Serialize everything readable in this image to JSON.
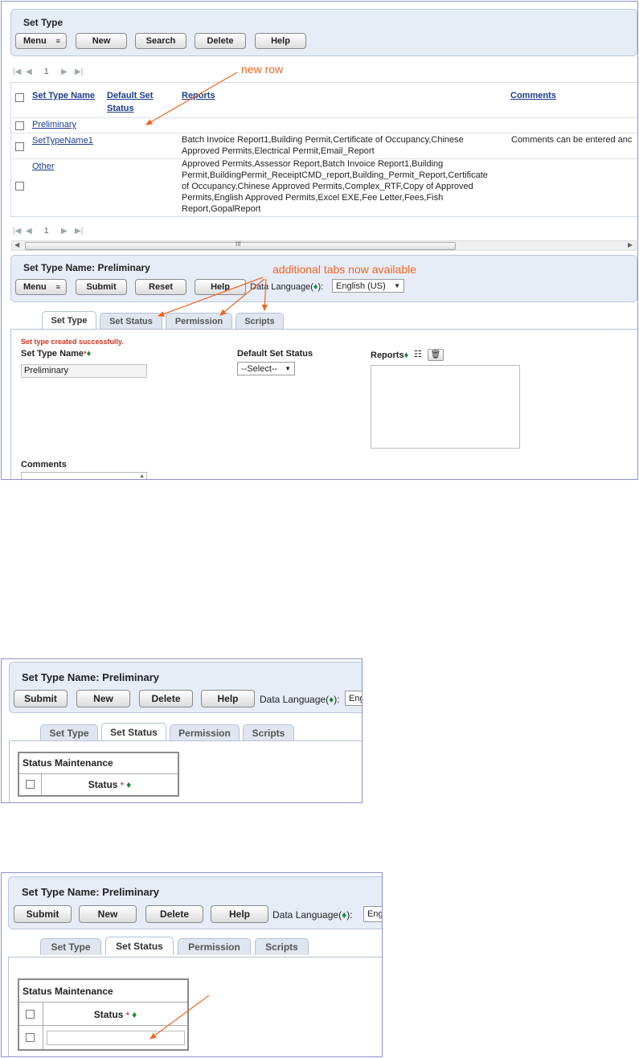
{
  "set_type_panel": {
    "title": "Set Type",
    "menu_label": "Menu",
    "buttons": {
      "new": "New",
      "search": "Search",
      "delete": "Delete",
      "help": "Help"
    }
  },
  "pager": {
    "page": "1"
  },
  "table": {
    "headers": {
      "name": "Set Type Name",
      "status_line1": "Default Set",
      "status_line2": "Status",
      "reports": "Reports",
      "comments": "Comments"
    },
    "rows": [
      {
        "name": "Preliminary",
        "reports": [],
        "comments": ""
      },
      {
        "name": "SetTypeName1",
        "reports": [
          "Batch Invoice Report1,Building Permit,Certificate of Occupancy,Chinese",
          "Approved Permits,Electrical Permit,Email_Report"
        ],
        "comments": "Comments can be entered anc"
      },
      {
        "name": "Other",
        "reports": [
          "Approved Permits,Assessor Report,Batch Invoice Report1,Building",
          "Permit,BuildingPermit_ReceiptCMD_report,Building_Permit_Report,Certificate",
          "of Occupancy,Chinese Approved Permits,Complex_RTF,Copy of Approved",
          "Permits,English Approved Permits,Excel EXE,Fee Letter,Fees,Fish",
          "Report,GopalReport"
        ],
        "comments": ""
      }
    ]
  },
  "annotations": {
    "new_row": "new row",
    "tabs_available": "additional tabs now available"
  },
  "detail_panel": {
    "title": "Set Type Name: Preliminary",
    "menu_label": "Menu",
    "buttons": {
      "submit": "Submit",
      "reset": "Reset",
      "help": "Help"
    },
    "data_language_prefix": "Data Language(",
    "data_language_suffix": "):",
    "language_value": "English (US)"
  },
  "tabs": {
    "set_type": "Set Type",
    "set_status": "Set Status",
    "permission": "Permission",
    "scripts": "Scripts"
  },
  "form": {
    "success_message": "Set type created successfully.",
    "set_type_name_label": "Set Type Name",
    "set_type_name_value": "Preliminary",
    "default_status_label": "Default Set Status",
    "default_status_value": "--Select--",
    "reports_label": "Reports",
    "comments_label": "Comments"
  },
  "status_panel": {
    "title": "Set Type Name: Preliminary",
    "buttons": {
      "submit": "Submit",
      "new": "New",
      "delete": "Delete",
      "help": "Help"
    },
    "data_language_prefix": "Data Language(",
    "data_language_suffix": "):",
    "language_partial_1": "Eng",
    "language_partial_2": "Eng",
    "status_maintenance": "Status Maintenance",
    "status_col": "Status"
  },
  "glyphs": {
    "diamond": "♦",
    "asterisk": "*",
    "caret_down": "▼",
    "menu_caret": "▾"
  },
  "colors": {
    "annotation": "#f26522",
    "link": "#1b3c8c",
    "panel_bg": "#e6edf7",
    "diamond": "#1a8a3a"
  }
}
